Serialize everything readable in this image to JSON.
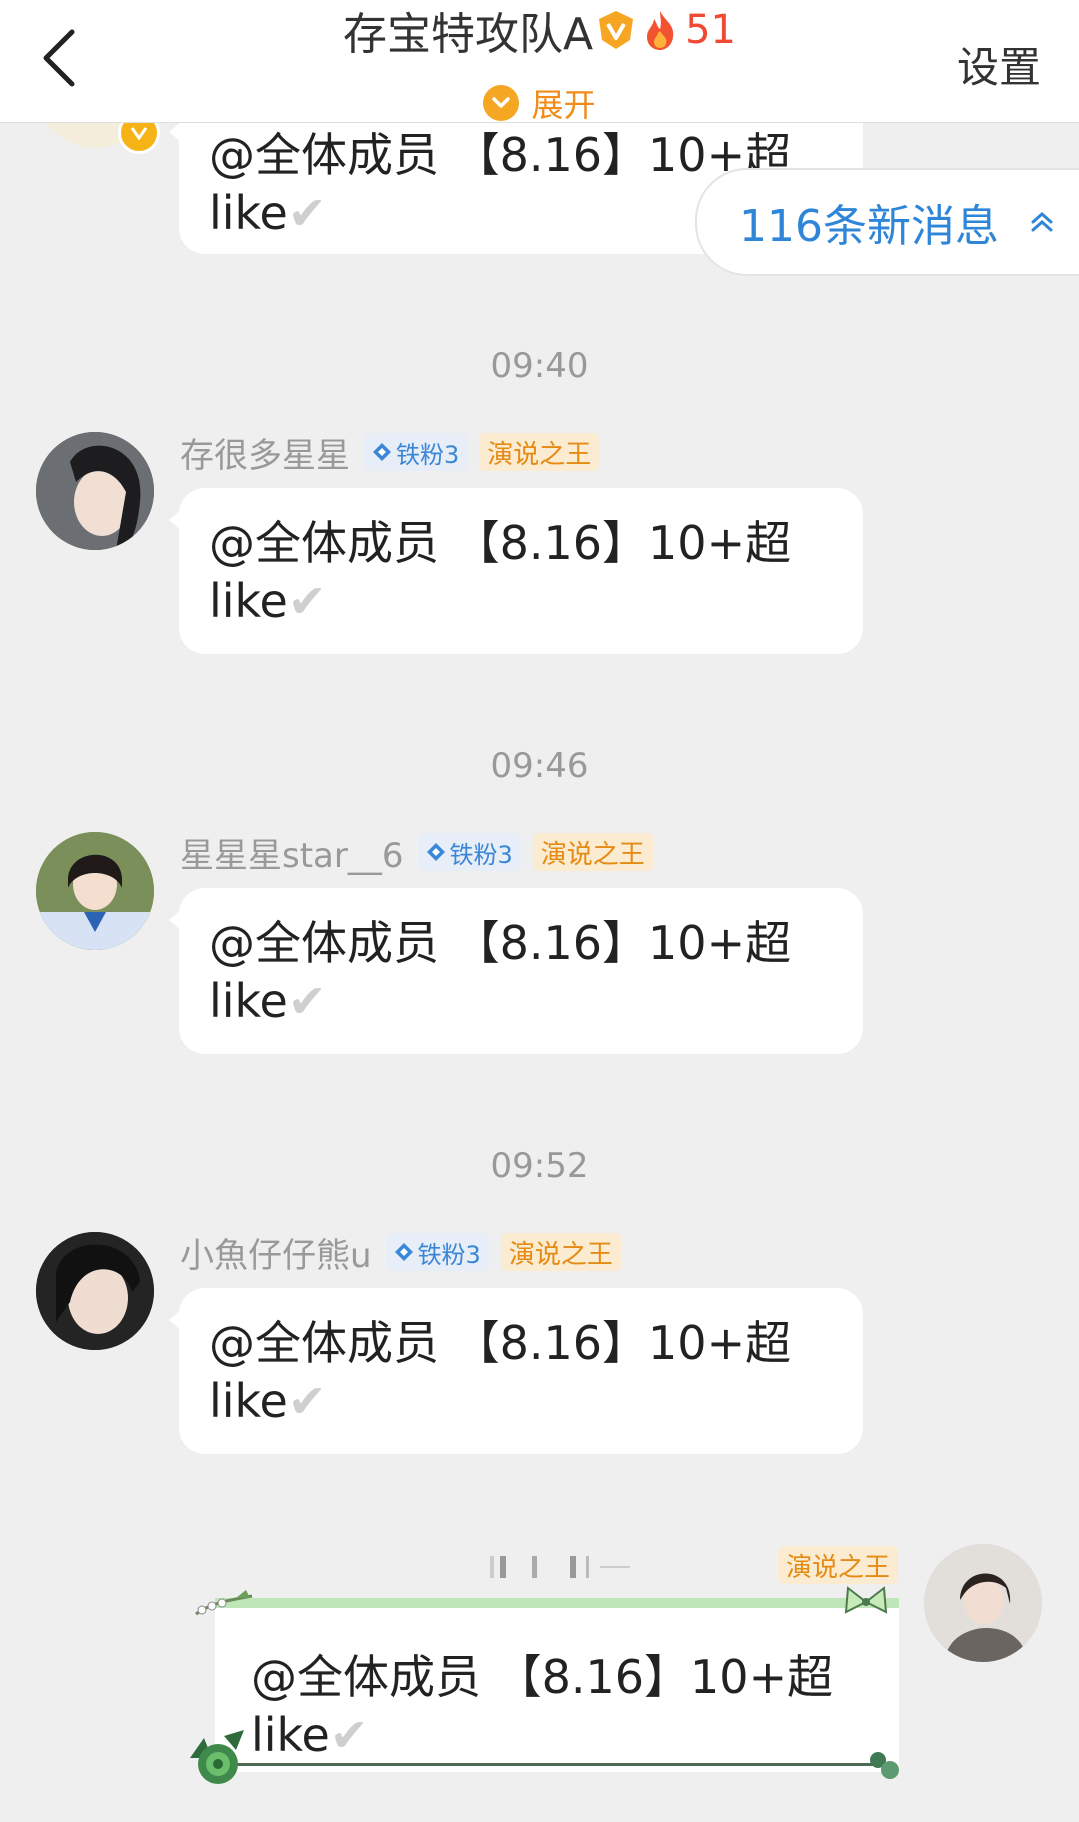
{
  "header": {
    "title": "存宝特攻队A",
    "count": "51",
    "expand_label": "展开",
    "settings_label": "设置"
  },
  "new_messages": "116条新消息",
  "messages": [
    {
      "time": "",
      "sender": "",
      "text": "@全体成员 【8.16】10+超",
      "text2": "like",
      "check": "✔"
    },
    {
      "time": "09:40",
      "sender": "存很多星星",
      "fan_badge": "铁粉3",
      "title_badge": "演说之王",
      "text": "@全体成员 【8.16】10+超",
      "text2": "like",
      "check": "✔"
    },
    {
      "time": "09:46",
      "sender": "星星星star__6",
      "fan_badge": "铁粉3",
      "title_badge": "演说之王",
      "text": "@全体成员 【8.16】10+超",
      "text2": "like",
      "check": "✔"
    },
    {
      "time": "09:52",
      "sender": "小魚仔仔熊u",
      "fan_badge": "铁粉3",
      "title_badge": "演说之王",
      "text": "@全体成员 【8.16】10+超",
      "text2": "like",
      "check": "✔"
    }
  ],
  "my_message": {
    "title_badge": "演说之王",
    "text": "@全体成员 【8.16】10+超",
    "text2": "like",
    "check": "✔"
  },
  "colors": {
    "accent_blue": "#2f86d8",
    "fire_red": "#f04a34",
    "gold": "#f5a623"
  }
}
